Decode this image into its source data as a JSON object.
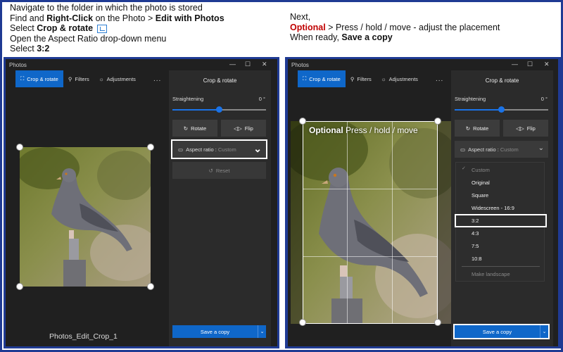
{
  "instructions_left": {
    "line1": "Navigate to the folder in which the photo is stored",
    "line2_a": "Find and ",
    "line2_b": "Right-Click",
    "line2_c": " on the Photo > ",
    "line2_d": "Edit with Photos",
    "line3_a": "Select ",
    "line3_b": "Crop & rotate",
    "line4": "Open the Aspect Ratio drop-down menu",
    "line5_a": "Select ",
    "line5_b": "3:2"
  },
  "instructions_right": {
    "line1": "Next,",
    "line2_a": "Optional",
    "line2_b": " > Press / hold / move - adjust the placement",
    "line3_a": "When ready, ",
    "line3_b": "Save a copy"
  },
  "app": {
    "title": "Photos",
    "tabs": {
      "crop": "Crop & rotate",
      "filters": "Filters",
      "adjustments": "Adjustments"
    },
    "more": "...",
    "panel_title": "Crop & rotate",
    "straightening_label": "Straightening",
    "straightening_value": "0 °",
    "rotate_label": "Rotate",
    "flip_label": "Flip",
    "aspect_label": "Aspect ratio : ",
    "aspect_value": "Custom",
    "reset_label": "Reset",
    "save_label": "Save a copy",
    "window_controls": {
      "minimize": "—",
      "maximize": "☐",
      "close": "✕"
    }
  },
  "caption": "Photos_Edit_Crop_1",
  "overlay": {
    "bold": "Optional",
    "rest": " Press / hold / move"
  },
  "dropdown": {
    "items": [
      "Custom",
      "Original",
      "Square",
      "Widescreen - 16:9",
      "3:2",
      "4:3",
      "7:5",
      "10:8",
      "Make landscape"
    ],
    "check": "✓"
  },
  "colors": {
    "accent": "#0f67c9",
    "highlight_red": "#c00000",
    "frame_blue": "#1f3a93"
  }
}
